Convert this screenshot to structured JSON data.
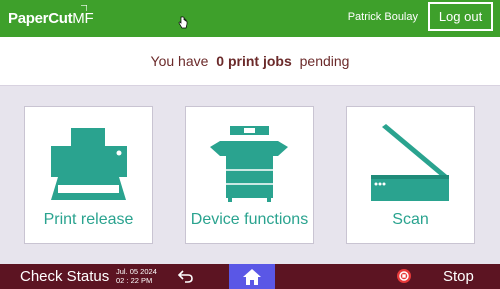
{
  "header": {
    "logo_main": "PaperCut",
    "logo_suffix": "MF",
    "user_name": "Patrick Boulay",
    "logout_label": "Log out"
  },
  "status": {
    "before": "You have ",
    "emphasis": "0 print jobs",
    "after": " pending"
  },
  "tiles": [
    {
      "label": "Print release",
      "icon": "printer-icon"
    },
    {
      "label": "Device functions",
      "icon": "copier-icon"
    },
    {
      "label": "Scan",
      "icon": "scanner-icon"
    }
  ],
  "footer": {
    "check_status": "Check Status",
    "date": "Jul. 05 2024",
    "time": "02 : 22 PM",
    "stop_label": "Stop"
  },
  "colors": {
    "header_green": "#3ea02b",
    "accent_teal": "#2aa38f",
    "footer_maroon": "#5c1422",
    "home_blue": "#5a57e6",
    "stop_red": "#e83a3a"
  }
}
